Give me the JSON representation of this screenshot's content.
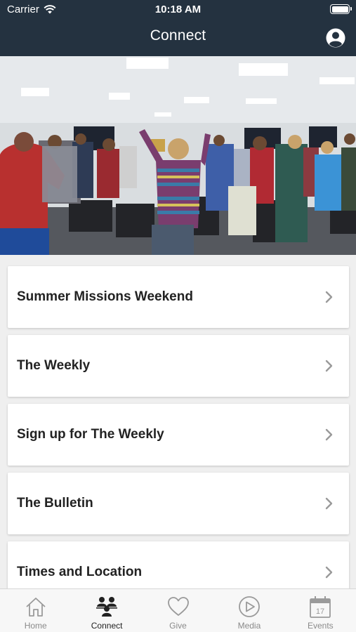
{
  "status_bar": {
    "carrier": "Carrier",
    "time": "10:18 AM"
  },
  "nav": {
    "title": "Connect",
    "profile_icon": "user-circle-icon"
  },
  "hero": {
    "description_icon": "worship-photo"
  },
  "list": {
    "items": [
      {
        "label": "Summer Missions Weekend"
      },
      {
        "label": "The Weekly"
      },
      {
        "label": "Sign up for The Weekly"
      },
      {
        "label": "The Bulletin"
      },
      {
        "label": "Times and Location"
      }
    ]
  },
  "tabs": [
    {
      "label": "Home",
      "icon": "home-icon"
    },
    {
      "label": "Connect",
      "icon": "people-icon"
    },
    {
      "label": "Give",
      "icon": "heart-icon"
    },
    {
      "label": "Media",
      "icon": "play-icon"
    },
    {
      "label": "Events",
      "icon": "calendar-icon",
      "badge": "17"
    }
  ],
  "colors": {
    "header": "#243240",
    "background": "#efefef",
    "active_tab": "#222222",
    "inactive_tab": "#8a8a8a"
  }
}
